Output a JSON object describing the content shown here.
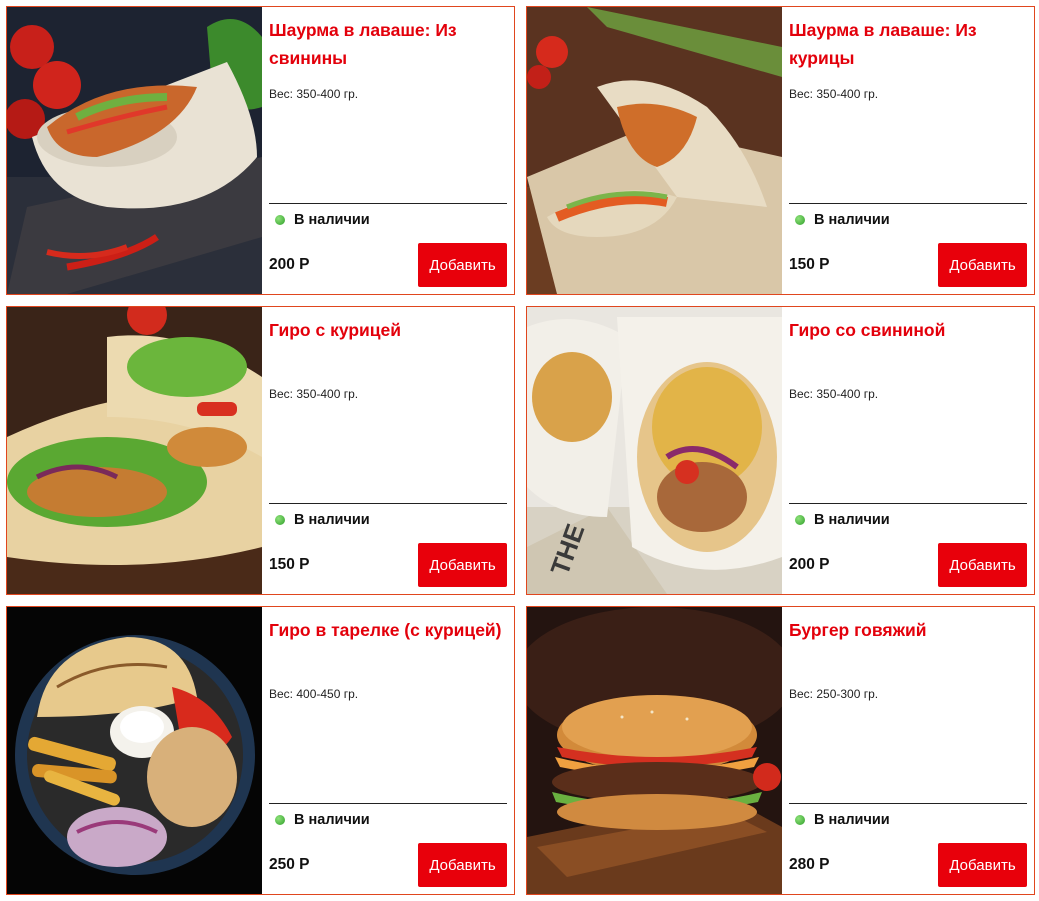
{
  "products": [
    {
      "title": "Шаурма в лаваше: Из свинины",
      "weight": "Вес: 350-400 гр.",
      "stock": "В наличии",
      "price": "200 Р",
      "button": "Добавить",
      "image": "shawarma-pork-photo"
    },
    {
      "title": "Шаурма в лаваше: Из курицы",
      "weight": "Вес: 350-400 гр.",
      "stock": "В наличии",
      "price": "150 Р",
      "button": "Добавить",
      "image": "shawarma-chicken-photo"
    },
    {
      "title": "Гиро с курицей",
      "weight": "Вес: 350-400 гр.",
      "stock": "В наличии",
      "price": "150 Р",
      "button": "Добавить",
      "image": "gyro-chicken-photo"
    },
    {
      "title": "Гиро со свининой",
      "weight": "Вес: 350-400 гр.",
      "stock": "В наличии",
      "price": "200 Р",
      "button": "Добавить",
      "image": "gyro-pork-photo"
    },
    {
      "title": "Гиро в тарелке (с курицей)",
      "weight": "Вес: 400-450 гр.",
      "stock": "В наличии",
      "price": "250 Р",
      "button": "Добавить",
      "image": "gyro-plate-photo"
    },
    {
      "title": "Бургер говяжий",
      "weight": "Вес: 250-300 гр.",
      "stock": "В наличии",
      "price": "280 Р",
      "button": "Добавить",
      "image": "beef-burger-photo"
    }
  ],
  "colors": {
    "accent": "#e3000b",
    "border": "#e0461e",
    "stock_dot": "#3aa832"
  }
}
